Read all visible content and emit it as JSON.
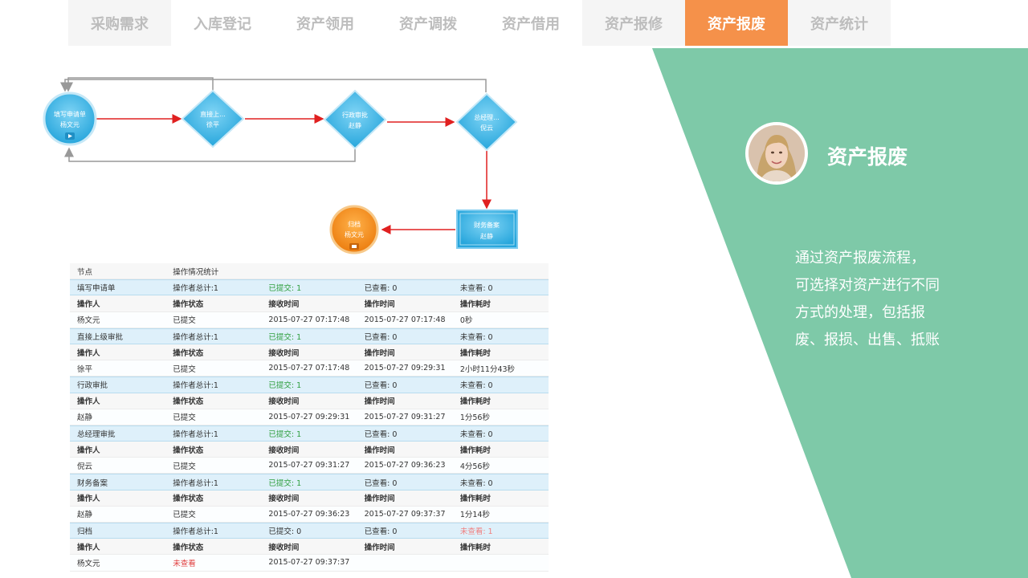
{
  "tabs": [
    {
      "label": "采购需求",
      "active": false
    },
    {
      "label": "入库登记",
      "active": false
    },
    {
      "label": "资产领用",
      "active": false
    },
    {
      "label": "资产调拨",
      "active": false
    },
    {
      "label": "资产借用",
      "active": false
    },
    {
      "label": "资产报修",
      "active": false
    },
    {
      "label": "资产报废",
      "active": true
    },
    {
      "label": "资产统计",
      "active": false
    }
  ],
  "panel": {
    "title": "资产报废",
    "desc_lines": [
      "通过资产报废流程，",
      "可选择对资产进行不同",
      "方式的处理，包括报",
      "废、报损、出售、抵账"
    ],
    "color": "#7ec9a8"
  },
  "flow": {
    "nodes": [
      {
        "line1": "填写申请单",
        "line2": "杨文元"
      },
      {
        "line1": "直接上...",
        "line2": "徐平"
      },
      {
        "line1": "行政审批",
        "line2": "赵静"
      },
      {
        "line1": "总经理...",
        "line2": "倪云"
      },
      {
        "line1": "财务备案",
        "line2": "赵静"
      },
      {
        "line1": "归档",
        "line2": "杨文元"
      }
    ]
  },
  "table": {
    "top": [
      "节点",
      "操作情况统计",
      "",
      "",
      ""
    ],
    "head": [
      "操作人",
      "操作状态",
      "接收时间",
      "操作时间",
      "操作耗时"
    ],
    "groups": [
      {
        "node": [
          "填写申请单",
          "操作者总计:1",
          "已提交: 1",
          "已查看: 0",
          "未查看: 0"
        ],
        "row": [
          "杨文元",
          "已提交",
          "2015-07-27 07:17:48",
          "2015-07-27 07:17:48",
          "0秒"
        ]
      },
      {
        "node": [
          "直接上级审批",
          "操作者总计:1",
          "已提交: 1",
          "已查看: 0",
          "未查看: 0"
        ],
        "row": [
          "徐平",
          "已提交",
          "2015-07-27 07:17:48",
          "2015-07-27 09:29:31",
          "2小时11分43秒"
        ]
      },
      {
        "node": [
          "行政审批",
          "操作者总计:1",
          "已提交: 1",
          "已查看: 0",
          "未查看: 0"
        ],
        "row": [
          "赵静",
          "已提交",
          "2015-07-27 09:29:31",
          "2015-07-27 09:31:27",
          "1分56秒"
        ]
      },
      {
        "node": [
          "总经理审批",
          "操作者总计:1",
          "已提交: 1",
          "已查看: 0",
          "未查看: 0"
        ],
        "row": [
          "倪云",
          "已提交",
          "2015-07-27 09:31:27",
          "2015-07-27 09:36:23",
          "4分56秒"
        ]
      },
      {
        "node": [
          "财务备案",
          "操作者总计:1",
          "已提交: 1",
          "已查看: 0",
          "未查看: 0"
        ],
        "row": [
          "赵静",
          "已提交",
          "2015-07-27 09:36:23",
          "2015-07-27 09:37:37",
          "1分14秒"
        ]
      },
      {
        "node": [
          "归档",
          "操作者总计:1",
          "已提交: 0",
          "已查看: 0",
          "未查看: 1"
        ],
        "row": [
          "杨文元",
          "未查看",
          "2015-07-27 09:37:37",
          "",
          ""
        ]
      }
    ]
  }
}
